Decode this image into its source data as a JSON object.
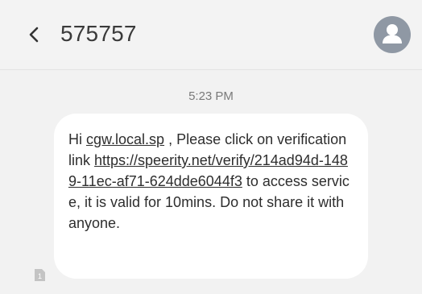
{
  "header": {
    "sender": "575757"
  },
  "thread": {
    "timestamp": "5:23 PM",
    "message": {
      "greeting": "Hi ",
      "user_link": "cgw.local.sp",
      "after_user": " , Please click on verification link ",
      "url_part1": "https://speerity.net/verify/214ad94d",
      "url_part2": "-1489-11ec-af71-624dde6044f3",
      "after_url": " to access service, it is valid for 10mins. Do not share it with anyone."
    },
    "sim_badge": "1"
  },
  "colors": {
    "avatar_bg": "#8f98a4",
    "bubble_bg": "#ffffff",
    "screen_bg": "#f2f2f2"
  },
  "icons": {
    "back": "back-arrow-icon",
    "avatar": "person-icon",
    "sim": "sim-card-icon"
  }
}
